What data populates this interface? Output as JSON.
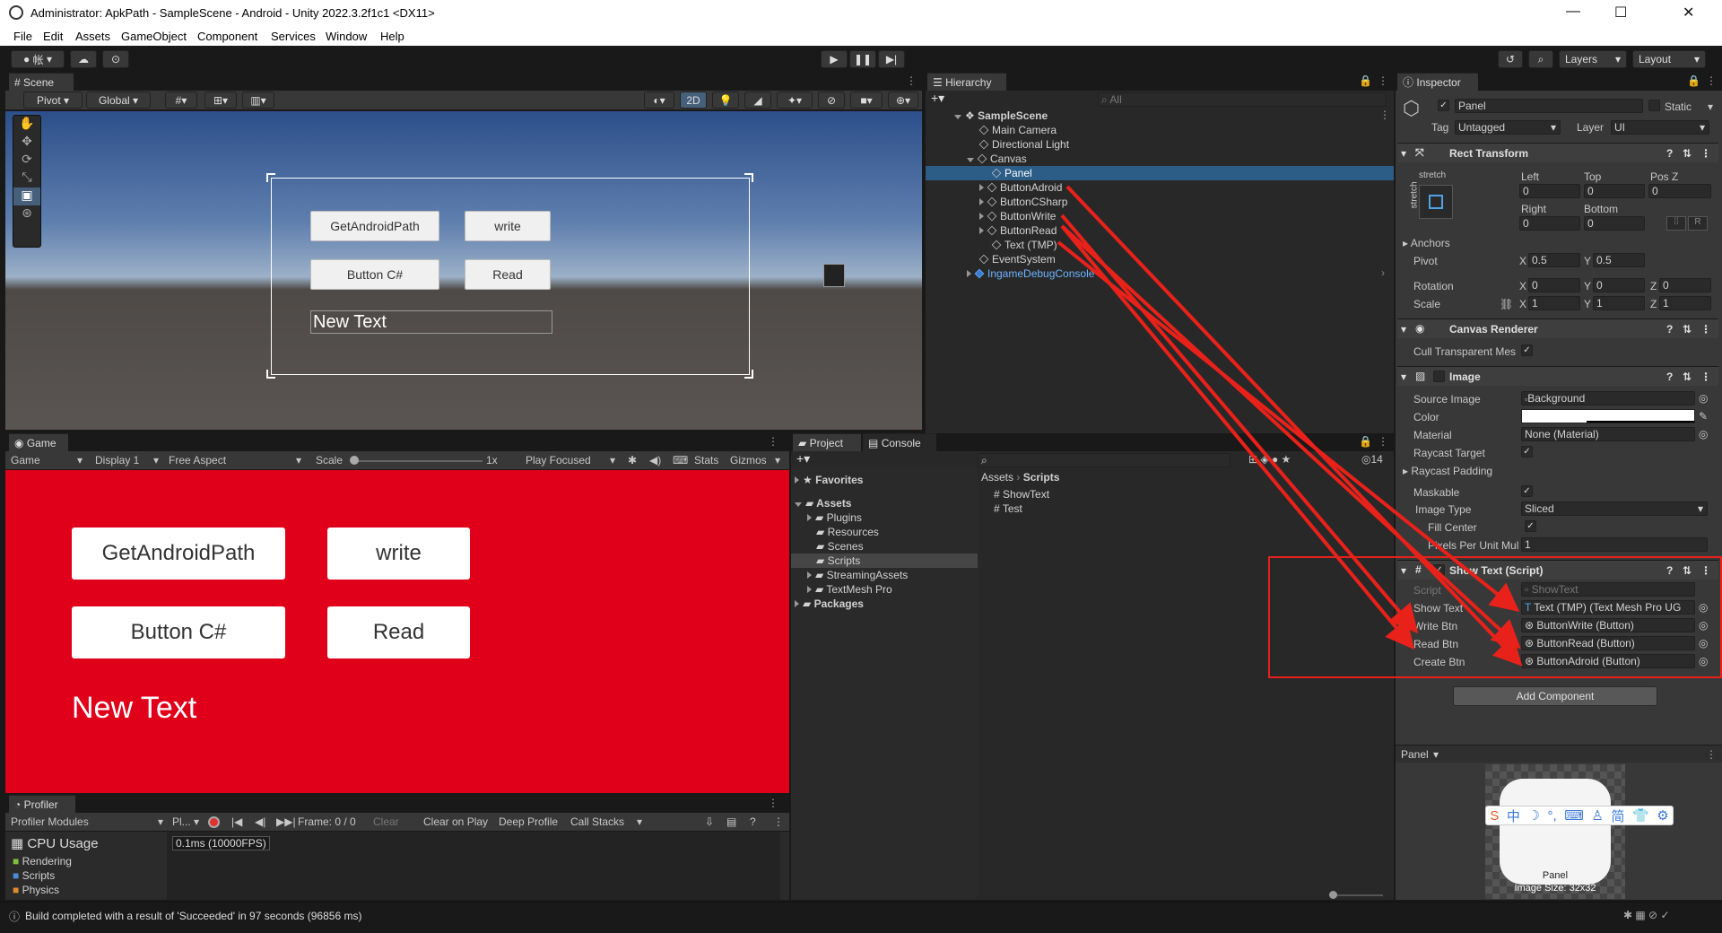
{
  "window": {
    "title": "Administrator: ApkPath - SampleScene - Android - Unity 2022.3.2f1c1 <DX11>",
    "minimize": "—",
    "maximize": "☐",
    "close": "✕"
  },
  "menu": [
    "File",
    "Edit",
    "Assets",
    "GameObject",
    "Component",
    "Services",
    "Window",
    "Help"
  ],
  "toolbar": {
    "layers": "Layers",
    "layout": "Layout",
    "account": "帐"
  },
  "scene": {
    "tab": "Scene",
    "pivot": "Pivot",
    "global": "Global",
    "mode2d": "2D",
    "buttons": [
      "GetAndroidPath",
      "write",
      "Button C#",
      "Read"
    ],
    "text": "New Text"
  },
  "game": {
    "tab": "Game",
    "game_dd": "Game",
    "display": "Display 1",
    "aspect": "Free Aspect",
    "scale_label": "Scale",
    "scale_val": "1x",
    "play_focused": "Play Focused",
    "stats": "Stats",
    "gizmos": "Gizmos",
    "buttons": [
      "GetAndroidPath",
      "write",
      "Button C#",
      "Read"
    ],
    "text": "New Text",
    "bg": "#e0001a"
  },
  "profiler": {
    "tab": "Profiler",
    "modules": "Profiler Modules",
    "pl": "Pl...",
    "frame": "Frame: 0 / 0",
    "clear": "Clear",
    "clear_on_play": "Clear on Play",
    "deep": "Deep Profile",
    "call_stacks": "Call Stacks",
    "cpu": "CPU Usage",
    "fps": "0.1ms (10000FPS)",
    "items": [
      "Rendering",
      "Scripts",
      "Physics"
    ]
  },
  "hierarchy": {
    "tab": "Hierarchy",
    "search": "All",
    "scene": "SampleScene",
    "items": [
      "Main Camera",
      "Directional Light",
      "Canvas",
      "Panel",
      "ButtonAdroid",
      "ButtonCSharp",
      "ButtonWrite",
      "ButtonRead",
      "Text (TMP)",
      "EventSystem",
      "IngameDebugConsole"
    ]
  },
  "project": {
    "tab": "Project",
    "console": "Console",
    "count": "14",
    "favorites": "Favorites",
    "assets": "Assets",
    "folders": [
      "Plugins",
      "Resources",
      "Scenes",
      "Scripts",
      "StreamingAssets",
      "TextMesh Pro"
    ],
    "packages": "Packages",
    "breadcrumb": [
      "Assets",
      "Scripts"
    ],
    "files": [
      "ShowText",
      "Test"
    ]
  },
  "inspector": {
    "tab": "Inspector",
    "name": "Panel",
    "static": "Static",
    "tag_label": "Tag",
    "tag": "Untagged",
    "layer_label": "Layer",
    "layer": "UI",
    "rect": {
      "title": "Rect Transform",
      "stretch": "stretch",
      "left": "Left",
      "top": "Top",
      "posz": "Pos Z",
      "right": "Right",
      "bottom": "Bottom",
      "v_left": "0",
      "v_top": "0",
      "v_posz": "0",
      "v_right": "0",
      "v_bottom": "0",
      "anchors": "Anchors",
      "pivot": "Pivot",
      "pivot_x": "0.5",
      "pivot_y": "0.5",
      "rotation": "Rotation",
      "rot_x": "0",
      "rot_y": "0",
      "rot_z": "0",
      "scale": "Scale",
      "sc_x": "1",
      "sc_y": "1",
      "sc_z": "1",
      "R": "R",
      "X": "X",
      "Y": "Y",
      "Z": "Z"
    },
    "canvas_renderer": {
      "title": "Canvas Renderer",
      "cull": "Cull Transparent Mes"
    },
    "image": {
      "title": "Image",
      "source_label": "Source Image",
      "source": "Background",
      "color_label": "Color",
      "material_label": "Material",
      "material": "None (Material)",
      "raycast_target": "Raycast Target",
      "raycast_padding": "Raycast Padding",
      "maskable": "Maskable",
      "image_type_label": "Image Type",
      "image_type": "Sliced",
      "fill_center": "Fill Center",
      "ppu_label": "Pixels Per Unit Mul",
      "ppu": "1"
    },
    "script": {
      "title": "Show Text (Script)",
      "script_label": "Script",
      "script": "ShowText",
      "show_text_label": "Show Text",
      "show_text": "Text (TMP) (Text Mesh Pro UG",
      "write_label": "Write Btn",
      "write": "ButtonWrite (Button)",
      "read_label": "Read Btn",
      "read": "ButtonRead (Button)",
      "create_label": "Create Btn",
      "create": "ButtonAdroid (Button)"
    },
    "add_component": "Add Component",
    "preview": {
      "title": "Panel",
      "label": "Panel",
      "size": "Image Size: 32x32"
    }
  },
  "ime": [
    "中",
    "☽",
    "°,",
    "⌨",
    "简",
    "👕",
    "⚙"
  ],
  "status": "Build completed with a result of 'Succeeded' in 97 seconds (96856 ms)",
  "colors": {
    "annotation": "#e8221a",
    "selection": "#2c5d87"
  }
}
